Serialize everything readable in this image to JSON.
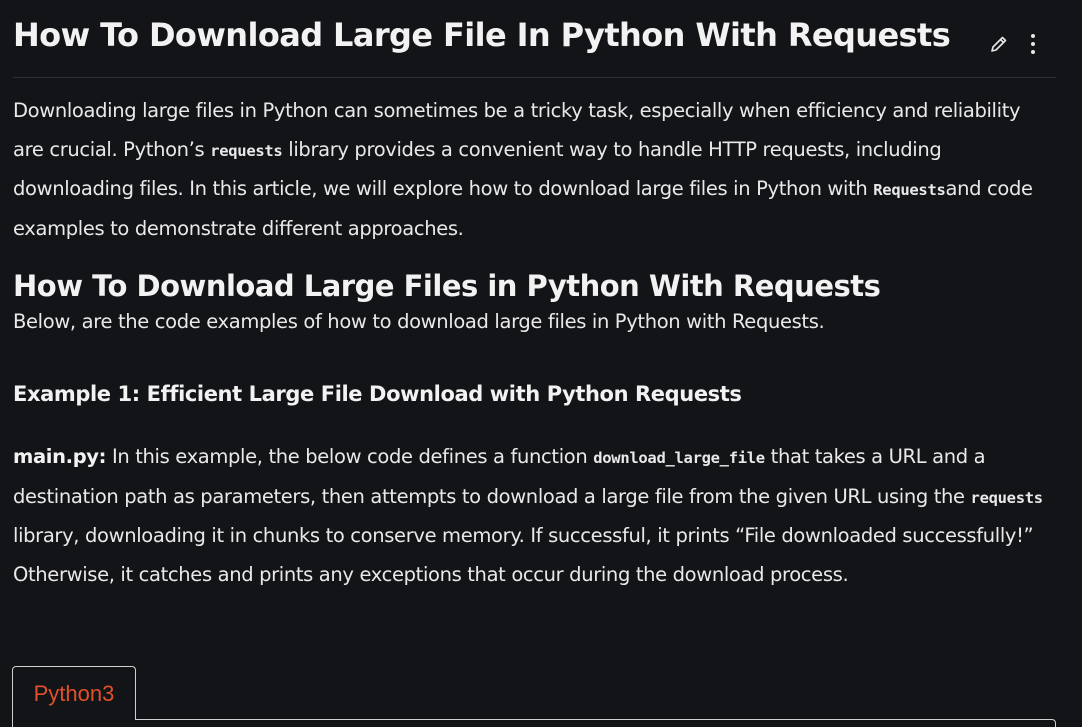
{
  "article": {
    "title": "How To Download Large File In Python With Requests",
    "intro": {
      "part1": "Downloading large files in Python can sometimes be a tricky task, especially when efficiency and reliability are crucial. Python’s ",
      "code1": "requests",
      "part2": " library provides a convenient way to handle HTTP requests, including downloading files. In this article, we will explore how to download large files in Python with ",
      "code2": "Requests",
      "part3": "and code examples to demonstrate different approaches."
    },
    "section_heading": "How To Download Large Files in Python With Requests",
    "section_intro": "Below, are the code examples of how to download large files in Python with Requests.",
    "example1": {
      "heading": "Example 1: Efficient Large File Download with Python Requests",
      "label": "main.py:",
      "part1": " In this example, the below code defines a function ",
      "code1": "download_large_file",
      "part2": " that takes a URL and a destination path as parameters, then attempts to download a large file from the given URL using the ",
      "code2": "requests",
      "part3": " library, downloading it in chunks to conserve memory. If successful, it prints “File downloaded successfully!” Otherwise, it catches and prints any exceptions that occur during the download process."
    }
  },
  "code_tabs": {
    "active_tab": "Python3"
  },
  "icons": {
    "edit": "pencil-icon",
    "more": "more-vertical-icon"
  },
  "colors": {
    "background": "#131417",
    "text": "#e9e9e9",
    "tab_accent": "#e0502a"
  }
}
